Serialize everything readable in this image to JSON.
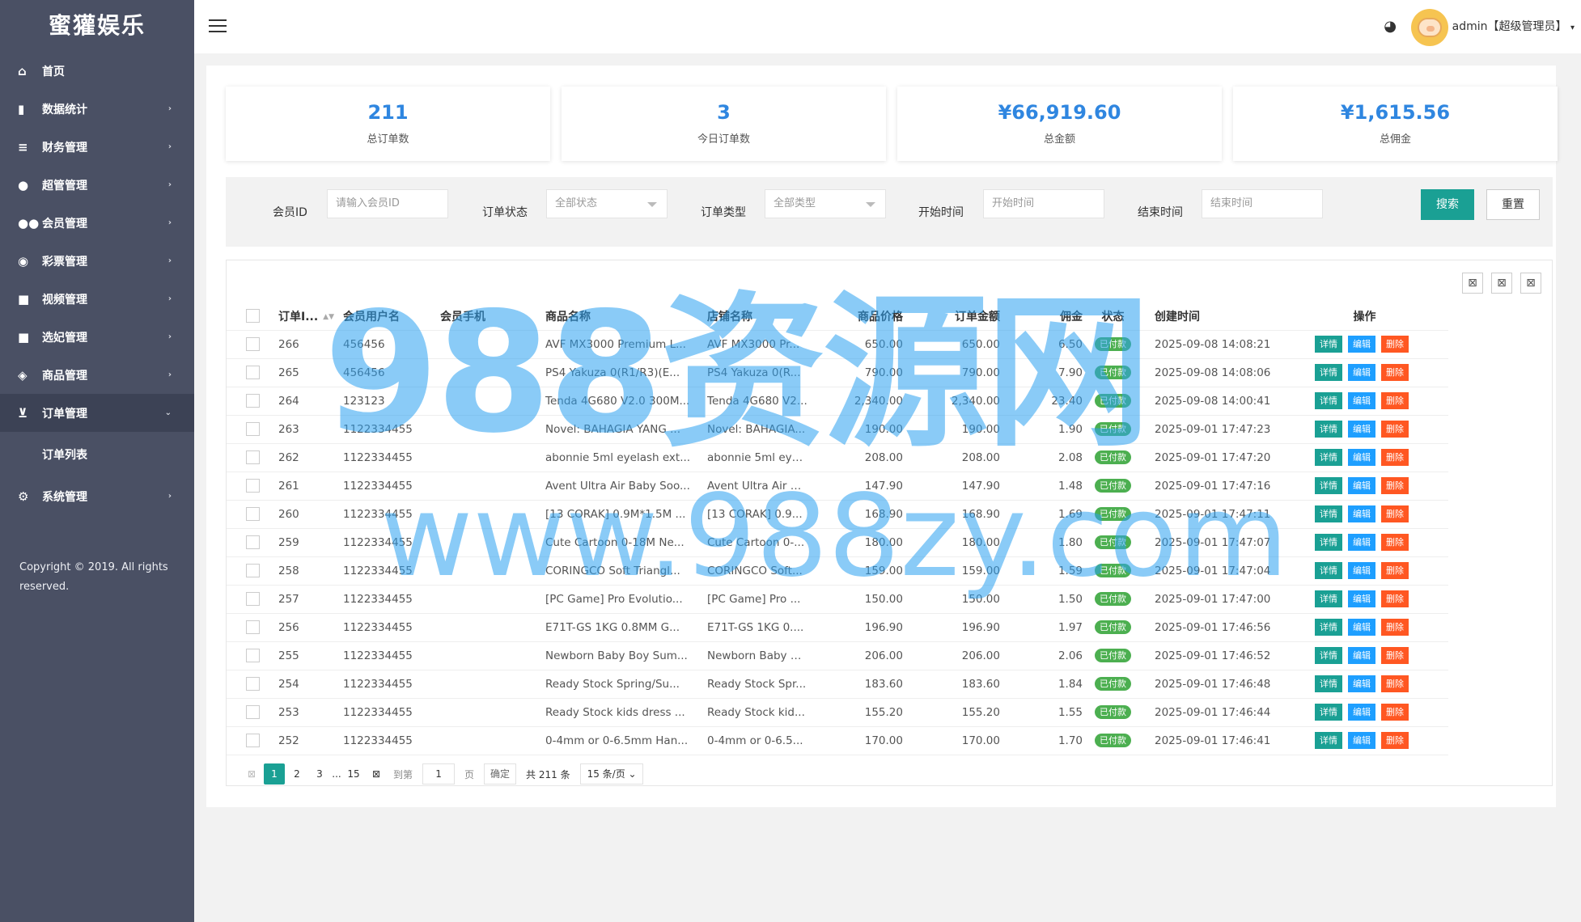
{
  "app": {
    "title": "蜜獾娱乐"
  },
  "sidebar": {
    "items": [
      {
        "label": "首页",
        "icon": "home-icon"
      },
      {
        "label": "数据统计",
        "icon": "bar-chart-icon"
      },
      {
        "label": "财务管理",
        "icon": "bank-icon"
      },
      {
        "label": "超管管理",
        "icon": "user-icon"
      },
      {
        "label": "会员管理",
        "icon": "users-icon"
      },
      {
        "label": "彩票管理",
        "icon": "gamepad-icon"
      },
      {
        "label": "视频管理",
        "icon": "video-icon"
      },
      {
        "label": "选妃管理",
        "icon": "video-icon"
      },
      {
        "label": "商品管理",
        "icon": "cube-icon"
      },
      {
        "label": "订单管理",
        "icon": "cart-icon"
      },
      {
        "label": "系统管理",
        "icon": "gear-icon"
      }
    ],
    "sub_items": [
      {
        "label": "订单列表"
      }
    ],
    "copyright": "Copyright © 2019. All rights reserved."
  },
  "header": {
    "user": "admin【超级管理员】"
  },
  "stats": [
    {
      "value": "211",
      "label": "总订单数"
    },
    {
      "value": "3",
      "label": "今日订单数"
    },
    {
      "value": "¥66,919.60",
      "label": "总金额"
    },
    {
      "value": "¥1,615.56",
      "label": "总佣金"
    }
  ],
  "filter": {
    "member_id_label": "会员ID",
    "member_id_placeholder": "请输入会员ID",
    "status_label": "订单状态",
    "status_value": "全部状态",
    "type_label": "订单类型",
    "type_value": "全部类型",
    "start_label": "开始时间",
    "start_placeholder": "开始时间",
    "end_label": "结束时间",
    "end_placeholder": "结束时间",
    "search_button": "搜索",
    "reset_button": "重置"
  },
  "table": {
    "headers": [
      "订单I...",
      "会员用户名",
      "会员手机",
      "商品名称",
      "店铺名称",
      "商品价格",
      "订单金额",
      "佣金",
      "状态",
      "创建时间",
      "操作"
    ],
    "actions": {
      "detail": "详情",
      "edit": "编辑",
      "delete": "删除"
    },
    "rows": [
      {
        "id": "266",
        "user": "456456",
        "phone": "",
        "product": "AVF MX3000 Premium L...",
        "shop": "AVF MX3000 Pr...",
        "price": "650.00",
        "amount": "650.00",
        "commission": "6.50",
        "status": "已付款",
        "time": "2025-09-08 14:08:21"
      },
      {
        "id": "265",
        "user": "456456",
        "phone": "",
        "product": "PS4 Yakuza 0(R1/R3)(E...",
        "shop": "PS4 Yakuza 0(R...",
        "price": "790.00",
        "amount": "790.00",
        "commission": "7.90",
        "status": "已付款",
        "time": "2025-09-08 14:08:06"
      },
      {
        "id": "264",
        "user": "123123",
        "phone": "",
        "product": "Tenda 4G680 V2.0 300M...",
        "shop": "Tenda 4G680 V2...",
        "price": "2,340.00",
        "amount": "2,340.00",
        "commission": "23.40",
        "status": "已付款",
        "time": "2025-09-08 14:00:41"
      },
      {
        "id": "263",
        "user": "1122334455",
        "phone": "",
        "product": "Novel: BAHAGIA YANG ...",
        "shop": "Novel: BAHAGIA...",
        "price": "190.00",
        "amount": "190.00",
        "commission": "1.90",
        "status": "已付款",
        "time": "2025-09-01 17:47:23"
      },
      {
        "id": "262",
        "user": "1122334455",
        "phone": "",
        "product": "abonnie 5ml eyelash ext...",
        "shop": "abonnie 5ml eyel...",
        "price": "208.00",
        "amount": "208.00",
        "commission": "2.08",
        "status": "已付款",
        "time": "2025-09-01 17:47:20"
      },
      {
        "id": "261",
        "user": "1122334455",
        "phone": "",
        "product": "Avent Ultra Air Baby Soo...",
        "shop": "Avent Ultra Air B...",
        "price": "147.90",
        "amount": "147.90",
        "commission": "1.48",
        "status": "已付款",
        "time": "2025-09-01 17:47:16"
      },
      {
        "id": "260",
        "user": "1122334455",
        "phone": "",
        "product": "[13 CORAK] 0.9M*1.5M ...",
        "shop": "[13 CORAK] 0.9...",
        "price": "168.90",
        "amount": "168.90",
        "commission": "1.69",
        "status": "已付款",
        "time": "2025-09-01 17:47:11"
      },
      {
        "id": "259",
        "user": "1122334455",
        "phone": "",
        "product": "Cute Cartoon 0-18M Ne...",
        "shop": "Cute Cartoon 0-...",
        "price": "180.00",
        "amount": "180.00",
        "commission": "1.80",
        "status": "已付款",
        "time": "2025-09-01 17:47:07"
      },
      {
        "id": "258",
        "user": "1122334455",
        "phone": "",
        "product": "CORINGCO Soft Triangl...",
        "shop": "CORINGCO Soft...",
        "price": "159.00",
        "amount": "159.00",
        "commission": "1.59",
        "status": "已付款",
        "time": "2025-09-01 17:47:04"
      },
      {
        "id": "257",
        "user": "1122334455",
        "phone": "",
        "product": "[PC Game] Pro Evolutio...",
        "shop": "[PC Game] Pro ...",
        "price": "150.00",
        "amount": "150.00",
        "commission": "1.50",
        "status": "已付款",
        "time": "2025-09-01 17:47:00"
      },
      {
        "id": "256",
        "user": "1122334455",
        "phone": "",
        "product": "E71T-GS 1KG 0.8MM G...",
        "shop": "E71T-GS 1KG 0....",
        "price": "196.90",
        "amount": "196.90",
        "commission": "1.97",
        "status": "已付款",
        "time": "2025-09-01 17:46:56"
      },
      {
        "id": "255",
        "user": "1122334455",
        "phone": "",
        "product": "Newborn Baby Boy Sum...",
        "shop": "Newborn Baby B...",
        "price": "206.00",
        "amount": "206.00",
        "commission": "2.06",
        "status": "已付款",
        "time": "2025-09-01 17:46:52"
      },
      {
        "id": "254",
        "user": "1122334455",
        "phone": "",
        "product": "Ready Stock Spring/Su...",
        "shop": "Ready Stock Spr...",
        "price": "183.60",
        "amount": "183.60",
        "commission": "1.84",
        "status": "已付款",
        "time": "2025-09-01 17:46:48"
      },
      {
        "id": "253",
        "user": "1122334455",
        "phone": "",
        "product": "Ready Stock kids dress ...",
        "shop": "Ready Stock kid...",
        "price": "155.20",
        "amount": "155.20",
        "commission": "1.55",
        "status": "已付款",
        "time": "2025-09-01 17:46:44"
      },
      {
        "id": "252",
        "user": "1122334455",
        "phone": "",
        "product": "0-4mm or 0-6.5mm Han...",
        "shop": "0-4mm or 0-6.5...",
        "price": "170.00",
        "amount": "170.00",
        "commission": "1.70",
        "status": "已付款",
        "time": "2025-09-01 17:46:41"
      }
    ]
  },
  "pagination": {
    "pages": [
      "1",
      "2",
      "3",
      "...",
      "15"
    ],
    "current": "1",
    "goto_label": "到第",
    "goto_value": "1",
    "page_unit": "页",
    "confirm": "确定",
    "total": "共 211 条",
    "page_size": "15 条/页"
  },
  "watermark": {
    "line1": "988资源网",
    "line2": "www.988zy.com"
  },
  "colors": {
    "sidebar": "#4a5064",
    "accent": "#1aa094",
    "stat_number": "#2f86e0",
    "badge_green": "#4caf50",
    "edit_blue": "#1e9fff",
    "delete_orange": "#ff5722"
  }
}
